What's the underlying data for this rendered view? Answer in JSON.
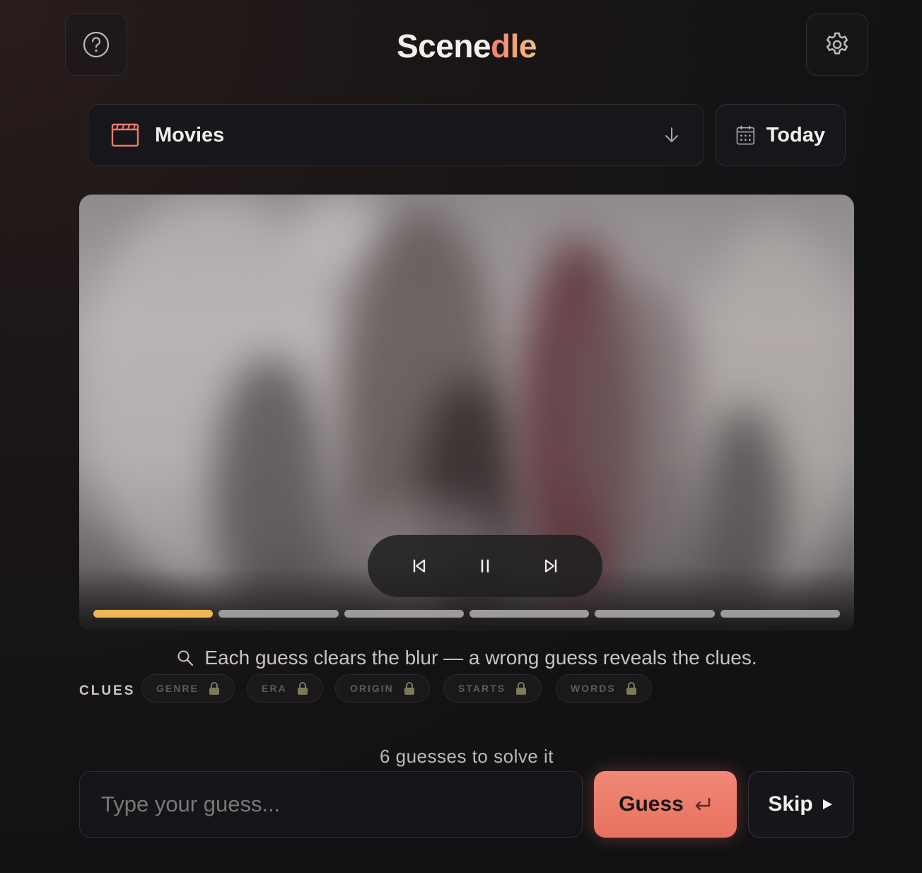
{
  "header": {
    "logo_part1": "Scene",
    "logo_part2": "dle",
    "help_icon": "question-circle-icon",
    "settings_icon": "gear-icon"
  },
  "category": {
    "selected": "Movies",
    "icon": "clapperboard-icon",
    "dropdown_icon": "arrow-down-icon"
  },
  "date": {
    "label": "Today",
    "icon": "calendar-icon"
  },
  "player": {
    "controls": [
      "previous-icon",
      "pause-icon",
      "next-icon"
    ],
    "clips_total": 6,
    "clip_current": 1
  },
  "hint": {
    "icon": "search-icon",
    "text": "Each guess clears the blur — a wrong guess reveals the clues."
  },
  "clues": {
    "label": "CLUES",
    "items": [
      {
        "label": "GENRE",
        "locked": true
      },
      {
        "label": "ERA",
        "locked": true
      },
      {
        "label": "ORIGIN",
        "locked": true
      },
      {
        "label": "STARTS",
        "locked": true
      },
      {
        "label": "WORDS",
        "locked": true
      }
    ]
  },
  "guesses_text": "6 guesses to solve it",
  "input": {
    "placeholder": "Type your guess..."
  },
  "buttons": {
    "guess": "Guess",
    "skip": "Skip"
  },
  "colors": {
    "accent": "#e8715f",
    "progress_active": "#f0b65a",
    "progress_inactive": "#9c9a9a"
  }
}
